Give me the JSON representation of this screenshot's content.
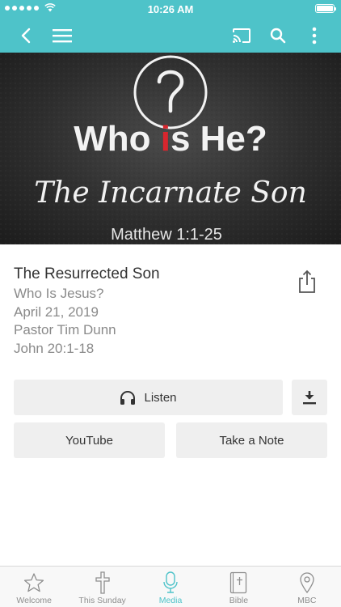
{
  "status_bar": {
    "time": "10:26 AM"
  },
  "hero": {
    "headline_before": "Who ",
    "headline_highlight": "i",
    "headline_after": "s He?",
    "script_title": "The Incarnate Son",
    "scripture": "Matthew 1:1-25"
  },
  "sermon": {
    "title": "The Resurrected Son",
    "series": "Who Is Jesus?",
    "date": "April 21, 2019",
    "speaker": "Pastor Tim Dunn",
    "passage": "John 20:1-18"
  },
  "actions": {
    "listen_label": "Listen",
    "youtube_label": "YouTube",
    "note_label": "Take a Note"
  },
  "tabs": [
    {
      "label": "Welcome",
      "icon": "star-icon"
    },
    {
      "label": "This Sunday",
      "icon": "cross-icon"
    },
    {
      "label": "Media",
      "icon": "microphone-icon"
    },
    {
      "label": "Bible",
      "icon": "bible-icon"
    },
    {
      "label": "MBC",
      "icon": "map-pin-icon"
    }
  ],
  "colors": {
    "accent": "#4ec3c9",
    "highlight_red": "#d9262e",
    "button_bg": "#efefef"
  }
}
